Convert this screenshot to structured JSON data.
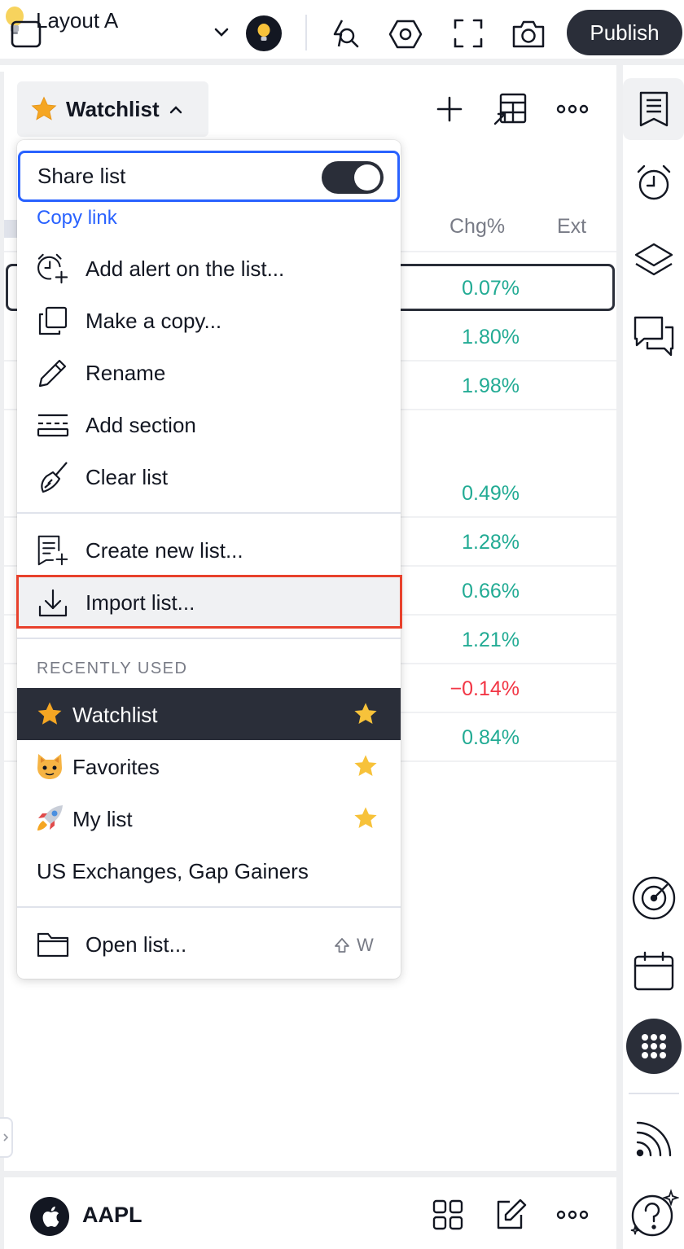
{
  "topbar": {
    "layout_name": "Layout A",
    "publish_label": "Publish",
    "icons": [
      "square-icon",
      "lightbulb-icon",
      "chevron-down-icon",
      "idea-icon",
      "alerts-search-icon",
      "settings-hexagon-icon",
      "fullscreen-icon",
      "camera-icon"
    ]
  },
  "watchlist": {
    "title": "Watchlist",
    "columns": {
      "chg": "Chg%",
      "ext": "Ext"
    },
    "rows": [
      {
        "chg": "0.07%",
        "negative": false
      },
      {
        "chg": "1.80%",
        "negative": false
      },
      {
        "chg": "1.98%",
        "negative": false
      },
      {
        "chg": "0.49%",
        "negative": false
      },
      {
        "chg": "1.28%",
        "negative": false
      },
      {
        "chg": "0.66%",
        "negative": false
      },
      {
        "chg": "1.21%",
        "negative": false
      },
      {
        "chg": "−0.14%",
        "negative": true
      },
      {
        "chg": "0.84%",
        "negative": false
      }
    ]
  },
  "menu": {
    "share_list": "Share list",
    "share_enabled": true,
    "copy_link": "Copy link",
    "items": {
      "add_alert": "Add alert on the list...",
      "make_copy": "Make a copy...",
      "rename": "Rename",
      "add_section": "Add section",
      "clear_list": "Clear list",
      "create_new": "Create new list...",
      "import_list": "Import list...",
      "open_list": "Open list..."
    },
    "recently_used_heading": "RECENTLY USED",
    "recent": [
      {
        "emoji": "⭐",
        "label": "Watchlist",
        "starred": true,
        "active": true
      },
      {
        "emoji": "😺",
        "label": "Favorites",
        "starred": true,
        "active": false
      },
      {
        "emoji": "🚀",
        "label": "My list",
        "starred": true,
        "active": false
      },
      {
        "emoji": "",
        "label": "US Exchanges, Gap Gainers",
        "starred": false,
        "active": false
      }
    ],
    "open_shortcut_key": "W"
  },
  "bottom": {
    "symbol": "AAPL"
  },
  "colors": {
    "accent": "#2962ff",
    "positive": "#22ab94",
    "negative": "#f23645",
    "highlight": "#e8412c",
    "dark": "#2a2e39"
  }
}
